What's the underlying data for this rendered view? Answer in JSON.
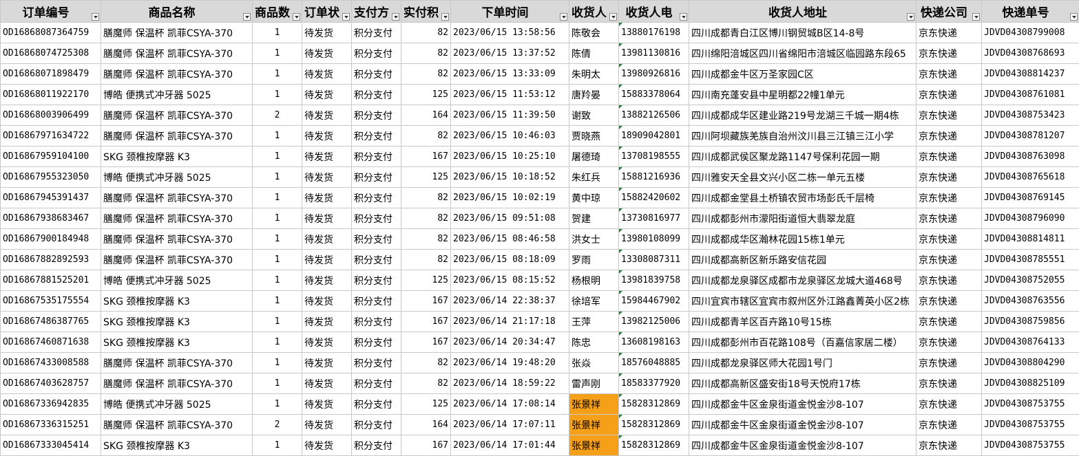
{
  "colors": {
    "header_bg": "#d9d9d9",
    "duplicate_highlight": "#f6a01a",
    "comment_marker": "#1a7f37",
    "grid": "#c8c8c8"
  },
  "columns": [
    "订单编号",
    "商品名称",
    "商品数",
    "订单状",
    "支付方",
    "实付积",
    "下单时间",
    "收货人",
    "收货人电",
    "收货人地址",
    "快递公司",
    "快递单号"
  ],
  "rows": [
    [
      "OD16868087364759",
      "膳魔师 保温杯 凯菲CSYA-370",
      "1",
      "待发货",
      "积分支付",
      "82",
      "2023/06/15 13:58:56",
      "陈敬会",
      "13880176198",
      "四川成都青白江区博川钢贸城B区14-8号",
      "京东快递",
      "JDVD04308799008"
    ],
    [
      "OD16868074725308",
      "膳魔师 保温杯 凯菲CSYA-370",
      "1",
      "待发货",
      "积分支付",
      "82",
      "2023/06/15 13:37:52",
      "陈倩",
      "13981130816",
      "四川绵阳涪城区四川省绵阳市涪城区临园路东段65",
      "京东快递",
      "JDVD04308768693"
    ],
    [
      "OD16868071898479",
      "膳魔师 保温杯 凯菲CSYA-370",
      "1",
      "待发货",
      "积分支付",
      "82",
      "2023/06/15 13:33:09",
      "朱明太",
      "13980926816",
      "四川成都金牛区万圣家园C区",
      "京东快递",
      "JDVD04308814237"
    ],
    [
      "OD16868011922170",
      "博皓 便携式冲牙器 5025",
      "1",
      "待发货",
      "积分支付",
      "125",
      "2023/06/15 11:53:12",
      "唐羚晏",
      "15883378064",
      "四川南充蓬安县中星明都22幢1单元",
      "京东快递",
      "JDVD04308761081"
    ],
    [
      "OD16868003906499",
      "膳魔师 保温杯 凯菲CSYA-370",
      "2",
      "待发货",
      "积分支付",
      "164",
      "2023/06/15 11:39:50",
      "谢致",
      "13882126506",
      "四川成都成华区建业路219号龙湖三千城一期4栋",
      "京东快递",
      "JDVD04308753423"
    ],
    [
      "OD16867971634722",
      "膳魔师 保温杯 凯菲CSYA-370",
      "1",
      "待发货",
      "积分支付",
      "82",
      "2023/06/15 10:46:03",
      "贾晓燕",
      "18909042801",
      "四川阿坝藏族羌族自治州汶川县三江镇三江小学",
      "京东快递",
      "JDVD04308781207"
    ],
    [
      "OD16867959104100",
      "SKG 颈椎按摩器 K3",
      "1",
      "待发货",
      "积分支付",
      "167",
      "2023/06/15 10:25:10",
      "屠德琦",
      "13708198555",
      "四川成都武侯区聚龙路1147号保利花园一期",
      "京东快递",
      "JDVD04308763098"
    ],
    [
      "OD16867955323050",
      "博皓 便携式冲牙器 5025",
      "1",
      "待发货",
      "积分支付",
      "125",
      "2023/06/15 10:18:52",
      "朱红兵",
      "15881216936",
      "四川雅安天全县文兴小区二栋一单元五楼",
      "京东快递",
      "JDVD04308765618"
    ],
    [
      "OD16867945391437",
      "膳魔师 保温杯 凯菲CSYA-370",
      "1",
      "待发货",
      "积分支付",
      "82",
      "2023/06/15 10:02:19",
      "黄中琼",
      "15882420602",
      "四川成都金堂县土桥镇农贸市场彭氏千层椅",
      "京东快递",
      "JDVD04308769145"
    ],
    [
      "OD16867938683467",
      "膳魔师 保温杯 凯菲CSYA-370",
      "1",
      "待发货",
      "积分支付",
      "82",
      "2023/06/15 09:51:08",
      "贺建",
      "13730816977",
      "四川成都彭州市濛阳街道恒大翡翠龙庭",
      "京东快递",
      "JDVD04308796090"
    ],
    [
      "OD16867900184948",
      "膳魔师 保温杯 凯菲CSYA-370",
      "1",
      "待发货",
      "积分支付",
      "82",
      "2023/06/15 08:46:58",
      "洪女士",
      "13980108099",
      "四川成都成华区瀚林花园15栋1单元",
      "京东快递",
      "JDVD04308814811"
    ],
    [
      "OD16867882892593",
      "膳魔师 保温杯 凯菲CSYA-370",
      "1",
      "待发货",
      "积分支付",
      "82",
      "2023/06/15 08:18:09",
      "罗雨",
      "13308087311",
      "四川成都高新区新乐路安信花园",
      "京东快递",
      "JDVD04308785551"
    ],
    [
      "OD16867881525201",
      "博皓 便携式冲牙器 5025",
      "1",
      "待发货",
      "积分支付",
      "125",
      "2023/06/15 08:15:52",
      "杨根明",
      "13981839758",
      "四川成都龙泉驿区成都市龙泉驿区龙城大道468号",
      "京东快递",
      "JDVD04308752055"
    ],
    [
      "OD16867535175554",
      "SKG 颈椎按摩器 K3",
      "1",
      "待发货",
      "积分支付",
      "167",
      "2023/06/14 22:38:37",
      "徐培军",
      "15984467902",
      "四川宜宾市辖区宜宾市叙州区外江路鑫菁英小区2栋",
      "京东快递",
      "JDVD04308763556"
    ],
    [
      "OD16867486387765",
      "SKG 颈椎按摩器 K3",
      "1",
      "待发货",
      "积分支付",
      "167",
      "2023/06/14 21:17:18",
      "王萍",
      "13982125006",
      "四川成都青羊区百卉路10号15栋",
      "京东快递",
      "JDVD04308759856"
    ],
    [
      "OD16867460871638",
      "SKG 颈椎按摩器 K3",
      "1",
      "待发货",
      "积分支付",
      "167",
      "2023/06/14 20:34:47",
      "陈忠",
      "13608198163",
      "四川成都彭州市百花路108号（百嘉信家居二楼）",
      "京东快递",
      "JDVD04308764133"
    ],
    [
      "OD16867433008588",
      "膳魔师 保温杯 凯菲CSYA-370",
      "1",
      "待发货",
      "积分支付",
      "82",
      "2023/06/14 19:48:20",
      "张焱",
      "18576048885",
      "四川成都龙泉驿区师大花园1号门",
      "京东快递",
      "JDVD04308804290"
    ],
    [
      "OD16867403628757",
      "膳魔师 保温杯 凯菲CSYA-370",
      "1",
      "待发货",
      "积分支付",
      "82",
      "2023/06/14 18:59:22",
      "雷声刚",
      "18583377920",
      "四川成都高新区盛安街18号天悦府17栋",
      "京东快递",
      "JDVD04308825109"
    ],
    [
      "OD16867336942835",
      "博皓 便携式冲牙器 5025",
      "1",
      "待发货",
      "积分支付",
      "125",
      "2023/06/14 17:08:14",
      "张景祥",
      "15828312869",
      "四川成都金牛区金泉街道金悦金沙8-107",
      "京东快递",
      "JDVD04308753755"
    ],
    [
      "OD16867336315251",
      "膳魔师 保温杯 凯菲CSYA-370",
      "2",
      "待发货",
      "积分支付",
      "164",
      "2023/06/14 17:07:11",
      "张景祥",
      "15828312869",
      "四川成都金牛区金泉街道金悦金沙8-107",
      "京东快递",
      "JDVD04308753755"
    ],
    [
      "OD16867333045414",
      "SKG 颈椎按摩器 K3",
      "1",
      "待发货",
      "积分支付",
      "167",
      "2023/06/14 17:01:44",
      "张景祥",
      "15828312869",
      "四川成都金牛区金泉街道金悦金沙8-107",
      "京东快递",
      "JDVD04308753755"
    ]
  ],
  "highlighted_recipient_rows": [
    18,
    19,
    20
  ]
}
